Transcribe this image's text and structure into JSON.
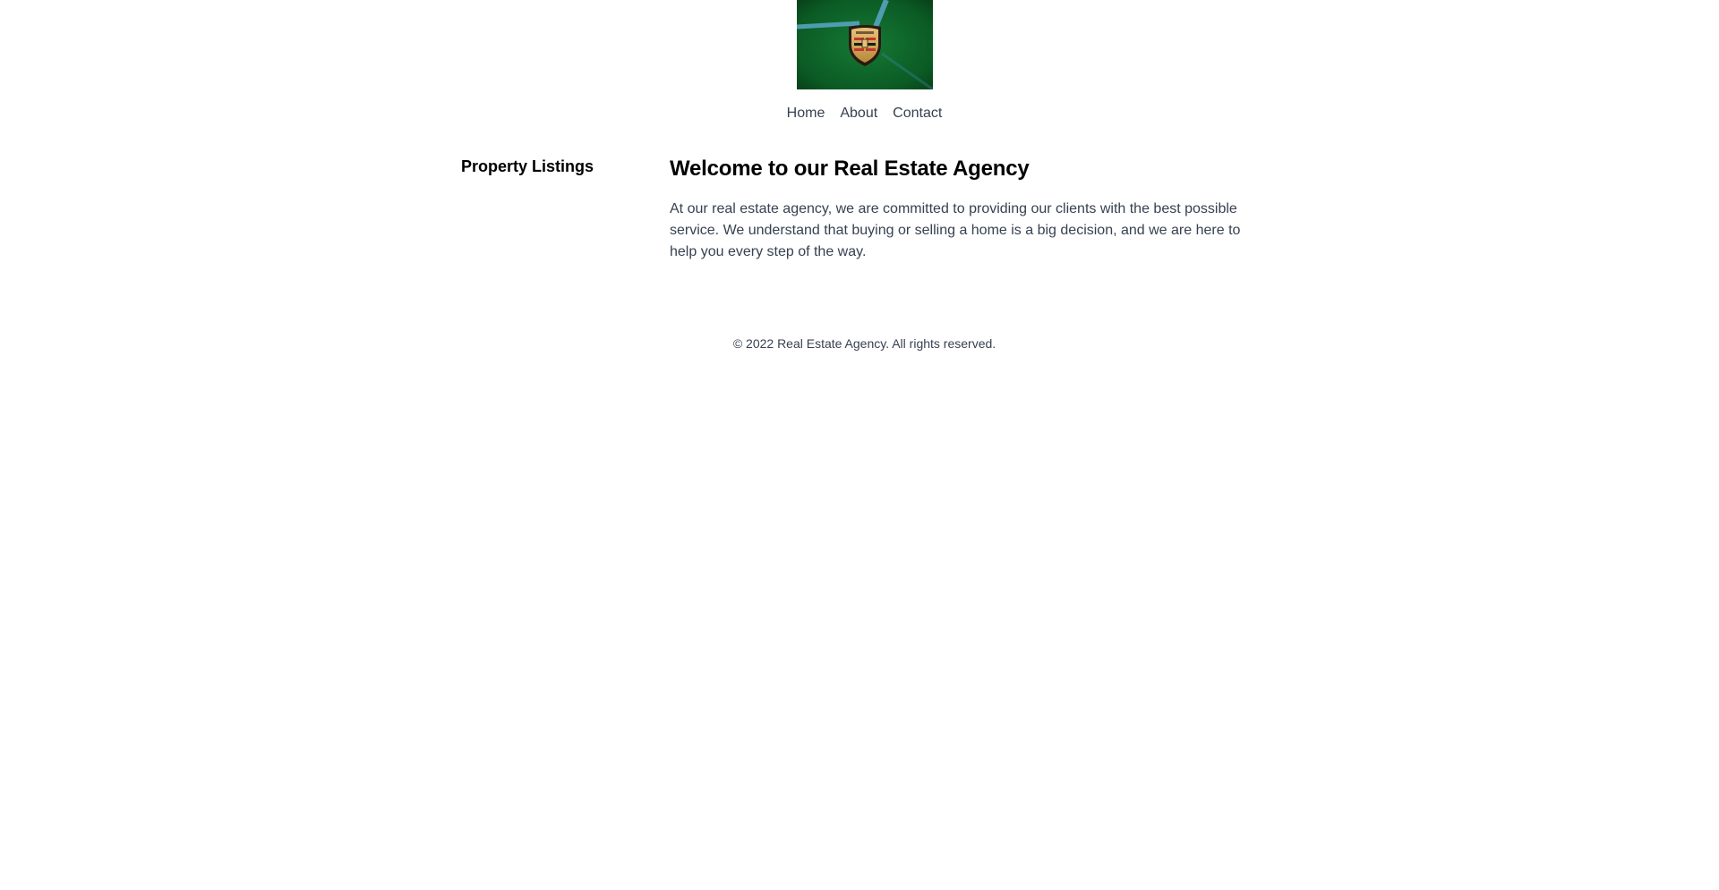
{
  "header": {
    "logo_alt": "Porsche crest logo"
  },
  "nav": {
    "items": [
      {
        "label": "Home"
      },
      {
        "label": "About"
      },
      {
        "label": "Contact"
      }
    ]
  },
  "sidebar": {
    "title": "Property Listings"
  },
  "main": {
    "title": "Welcome to our Real Estate Agency",
    "text": "At our real estate agency, we are committed to providing our clients with the best possible service. We understand that buying or selling a home is a big decision, and we are here to help you every step of the way."
  },
  "footer": {
    "text": "© 2022 Real Estate Agency. All rights reserved."
  }
}
